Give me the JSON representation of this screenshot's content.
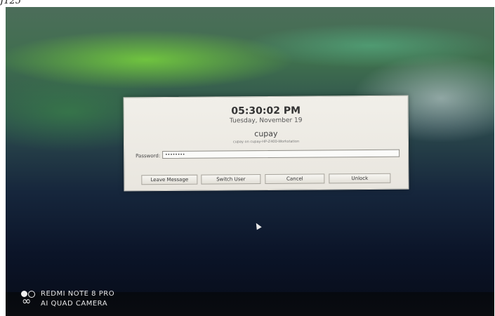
{
  "page_caption": "J125",
  "lock_dialog": {
    "time": "05:30:02 PM",
    "date": "Tuesday, November 19",
    "username": "cupay",
    "host_line": "cupay on cupay-HP-Z400-Workstation",
    "password_label": "Password:",
    "password_value": "••••••••",
    "buttons": {
      "leave_message": "Leave Message",
      "switch_user": "Switch User",
      "cancel": "Cancel",
      "unlock": "Unlock"
    }
  },
  "camera_watermark": {
    "line1": "REDMI NOTE 8 PRO",
    "line2": "AI QUAD CAMERA"
  },
  "icons": [
    "mouse-cursor-icon",
    "camera-logo-icon"
  ],
  "colors": {
    "dialog_background": "#eeebe4",
    "screen_dark": "#0b1428",
    "aurora_green": "#78d23c"
  }
}
